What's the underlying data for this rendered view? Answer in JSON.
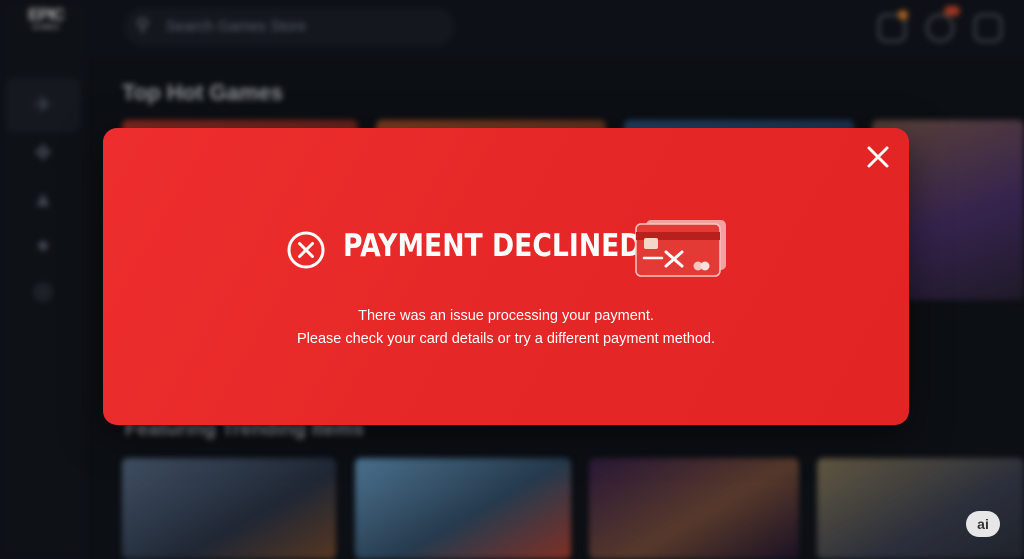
{
  "app": {
    "logo_line1": "EPIC",
    "logo_line2": "GAMES",
    "search_placeholder": "Search Games Store",
    "sidebar_icons": [
      "store-icon",
      "library-icon",
      "unreal-icon",
      "friends-icon",
      "discover-icon"
    ],
    "section1_title": "Top Hot Games",
    "section2_title": "Featuring Trending Items",
    "notifications_badge": "11"
  },
  "modal": {
    "title": "PAYMENT DECLINED",
    "line1": "There was an issue processing your payment.",
    "line2": "Please check your card details or try a different payment method.",
    "close_icon": "close-icon",
    "error_icon": "x-circle-icon",
    "card_icon": "declined-card-icon",
    "accent": "#e82a29"
  },
  "badge": {
    "label": "ai"
  }
}
